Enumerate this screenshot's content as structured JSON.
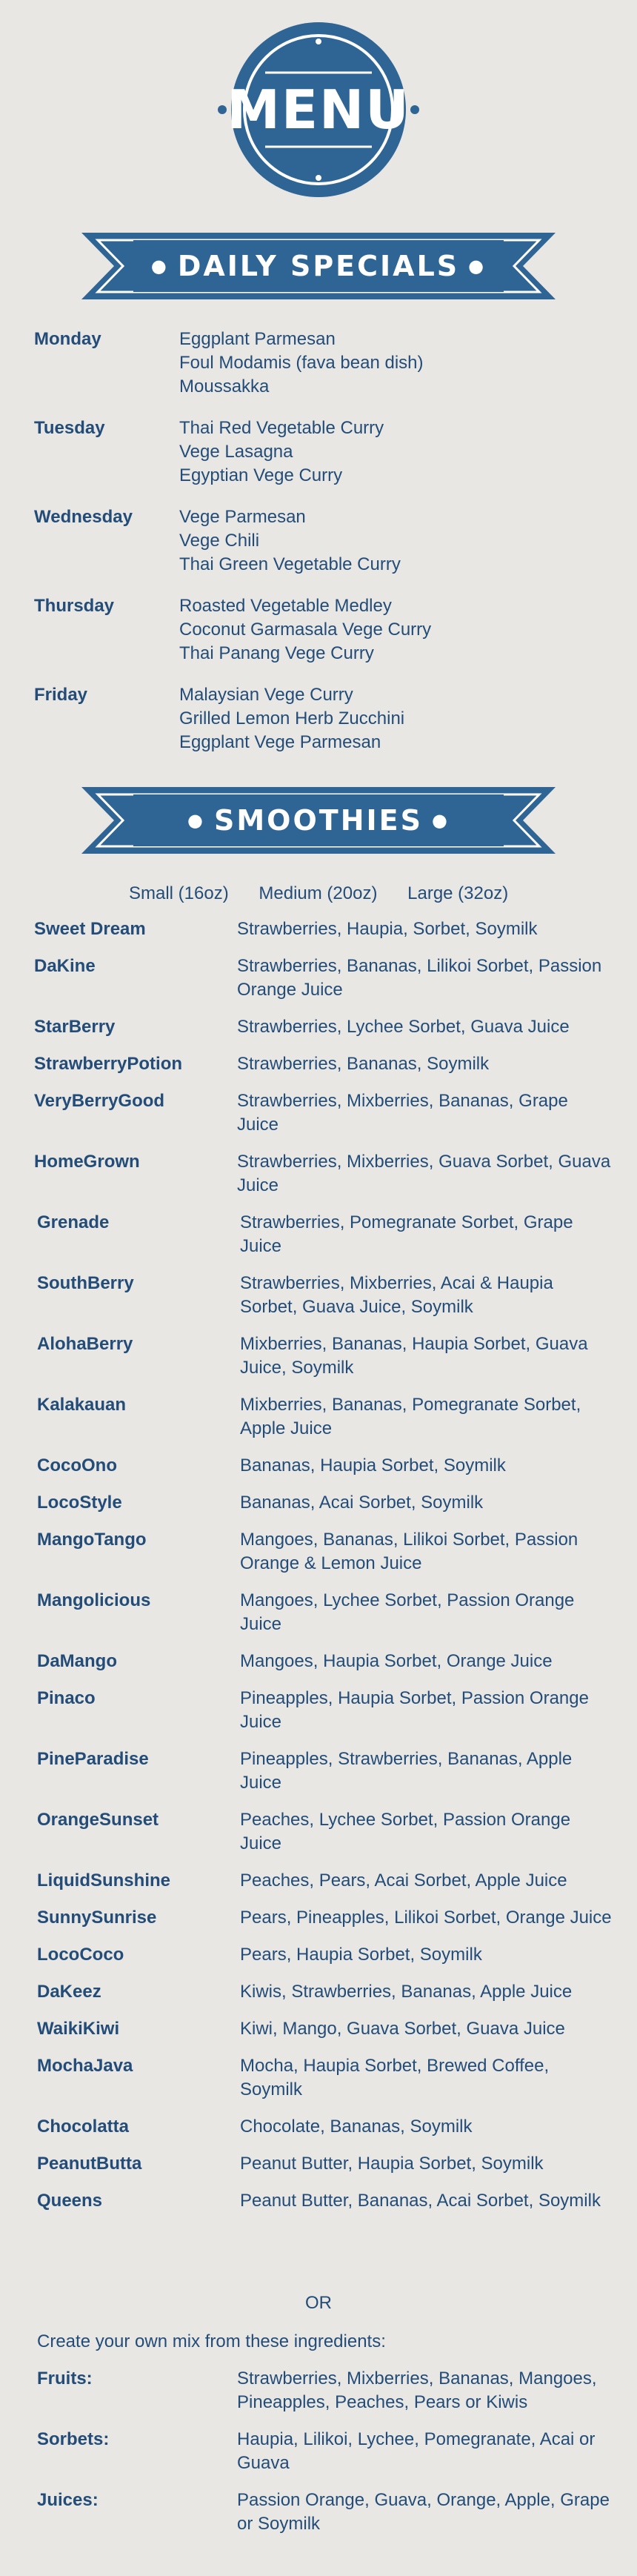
{
  "logo": {
    "text": "MENU"
  },
  "colors": {
    "primary": "#2f6595",
    "text": "#234d78",
    "background": "#e9e7e4"
  },
  "daily_specials": {
    "title": "DAILY SPECIALS",
    "days": [
      {
        "day": "Monday",
        "dishes": [
          "Eggplant Parmesan",
          "Foul Modamis (fava bean dish)",
          "Moussakka"
        ]
      },
      {
        "day": "Tuesday",
        "dishes": [
          "Thai Red Vegetable Curry",
          "Vege Lasagna",
          "Egyptian Vege Curry"
        ]
      },
      {
        "day": "Wednesday",
        "dishes": [
          "Vege Parmesan",
          "Vege Chili",
          "Thai Green Vegetable Curry"
        ]
      },
      {
        "day": "Thursday",
        "dishes": [
          "Roasted Vegetable Medley",
          "Coconut Garmasala Vege Curry",
          "Thai Panang Vege Curry"
        ]
      },
      {
        "day": "Friday",
        "dishes": [
          "Malaysian Vege Curry",
          "Grilled Lemon Herb Zucchini",
          "Eggplant Vege Parmesan"
        ]
      }
    ]
  },
  "smoothies": {
    "title": "SMOOTHIES",
    "sizes": [
      "Small (16oz)",
      "Medium (20oz)",
      "Large (32oz)"
    ],
    "items": [
      {
        "name": "Sweet Dream",
        "ingredients": "Strawberries, Haupia, Sorbet, Soymilk"
      },
      {
        "name": "DaKine",
        "ingredients": "Strawberries, Bananas, Lilikoi Sorbet, Passion Orange Juice"
      },
      {
        "name": "StarBerry",
        "ingredients": "Strawberries, Lychee Sorbet, Guava Juice"
      },
      {
        "name": "StrawberryPotion",
        "ingredients": "Strawberries, Bananas, Soymilk"
      },
      {
        "name": "VeryBerryGood",
        "ingredients": "Strawberries, Mixberries, Bananas, Grape Juice"
      },
      {
        "name": "HomeGrown",
        "ingredients": "Strawberries, Mixberries, Guava Sorbet, Guava Juice"
      },
      {
        "name": "Grenade",
        "ingredients": "Strawberries, Pomegranate Sorbet, Grape Juice"
      },
      {
        "name": "SouthBerry",
        "ingredients": "Strawberries, Mixberries, Acai & Haupia Sorbet, Guava Juice, Soymilk"
      },
      {
        "name": "AlohaBerry",
        "ingredients": "Mixberries, Bananas, Haupia Sorbet, Guava Juice, Soymilk"
      },
      {
        "name": "Kalakauan",
        "ingredients": "Mixberries, Bananas, Pomegranate Sorbet, Apple Juice"
      },
      {
        "name": "CocoOno",
        "ingredients": "Bananas, Haupia Sorbet, Soymilk"
      },
      {
        "name": "LocoStyle",
        "ingredients": "Bananas, Acai Sorbet, Soymilk"
      },
      {
        "name": "MangoTango",
        "ingredients": "Mangoes, Bananas, Lilikoi Sorbet, Passion Orange & Lemon Juice"
      },
      {
        "name": "Mangolicious",
        "ingredients": "Mangoes, Lychee Sorbet, Passion Orange Juice"
      },
      {
        "name": "DaMango",
        "ingredients": "Mangoes, Haupia Sorbet, Orange Juice"
      },
      {
        "name": "Pinaco",
        "ingredients": "Pineapples, Haupia Sorbet, Passion Orange Juice"
      },
      {
        "name": "PineParadise",
        "ingredients": "Pineapples, Strawberries, Bananas, Apple Juice"
      },
      {
        "name": "OrangeSunset",
        "ingredients": "Peaches, Lychee Sorbet, Passion Orange Juice"
      },
      {
        "name": "LiquidSunshine",
        "ingredients": "Peaches, Pears, Acai Sorbet, Apple Juice"
      },
      {
        "name": "SunnySunrise",
        "ingredients": "Pears, Pineapples, Lilikoi Sorbet, Orange Juice"
      },
      {
        "name": "LocoCoco",
        "ingredients": "Pears, Haupia Sorbet, Soymilk"
      },
      {
        "name": "DaKeez",
        "ingredients": "Kiwis, Strawberries, Bananas, Apple Juice"
      },
      {
        "name": "WaikiKiwi",
        "ingredients": "Kiwi, Mango, Guava Sorbet, Guava Juice"
      },
      {
        "name": "MochaJava",
        "ingredients": "Mocha, Haupia Sorbet, Brewed Coffee, Soymilk"
      },
      {
        "name": "Chocolatta",
        "ingredients": "Chocolate, Bananas, Soymilk"
      },
      {
        "name": "PeanutButta",
        "ingredients": "Peanut Butter, Haupia Sorbet, Soymilk"
      },
      {
        "name": "Queens",
        "ingredients": "Peanut Butter, Bananas, Acai Sorbet, Soymilk"
      }
    ],
    "or_text": "OR",
    "create_text": "Create your own mix from these ingredients:",
    "custom": [
      {
        "name": "Fruits:",
        "ingredients": "Strawberries, Mixberries, Bananas, Mangoes, Pineapples, Peaches, Pears or Kiwis"
      },
      {
        "name": "Sorbets:",
        "ingredients": "Haupia, Lilikoi, Lychee, Pomegranate, Acai or Guava"
      },
      {
        "name": "Juices:",
        "ingredients": "Passion Orange, Guava, Orange, Apple, Grape or Soymilk"
      }
    ]
  }
}
